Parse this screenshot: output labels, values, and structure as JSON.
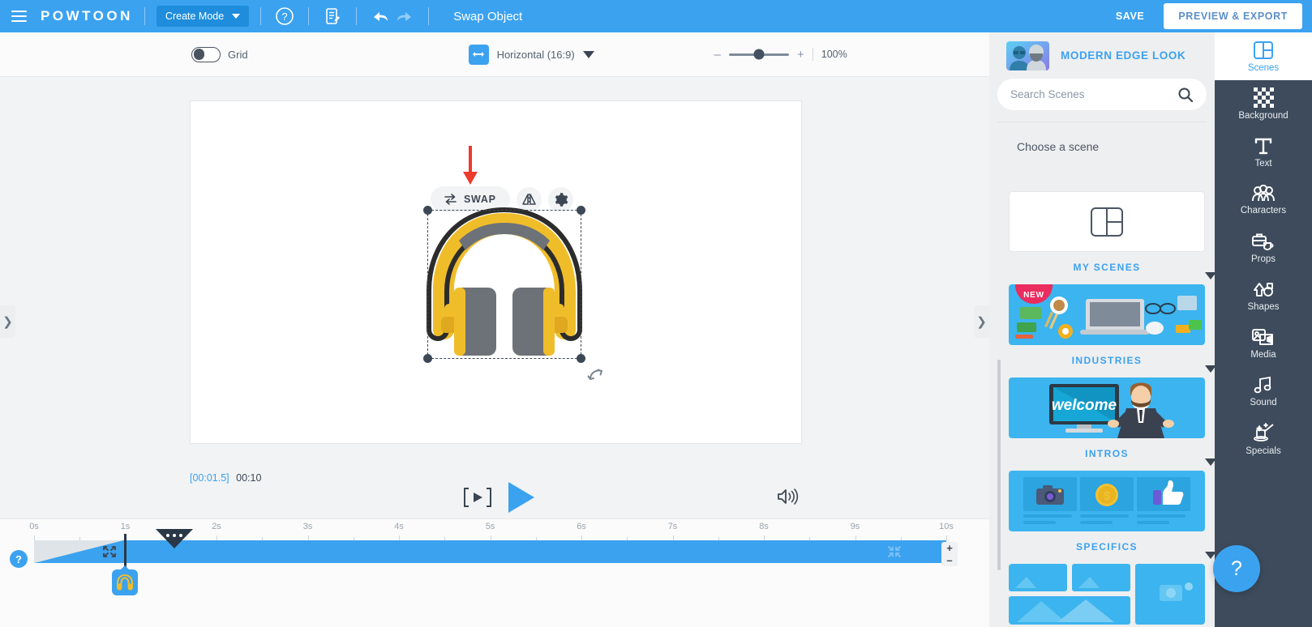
{
  "header": {
    "brand": "POWTOON",
    "menu_icon": "hamburger-icon",
    "create_mode_label": "Create Mode",
    "help_icon": "help-circle-icon",
    "notes_icon": "edit-document-icon",
    "undo_icon": "undo-arrow-icon",
    "redo_icon": "redo-arrow-icon",
    "doc_title": "Swap Object",
    "save_label": "SAVE",
    "preview_export_label": "PREVIEW & EXPORT"
  },
  "toolbar": {
    "grid_label": "Grid",
    "grid_on": false,
    "ratio_label": "Horizontal (16:9)",
    "ratio_icon": "horizontal-resize-icon",
    "zoom_minus": "–",
    "zoom_plus": "+",
    "zoom_value": "100%"
  },
  "object_toolbar": {
    "swap_label": "SWAP",
    "swap_icon": "swap-arrows-icon",
    "flip_icon": "flip-horizontal-icon",
    "settings_icon": "gear-icon",
    "pointer_icon": "red-down-arrow-annotation"
  },
  "canvas": {
    "object_name": "headphones-illustration",
    "left_collapse_icon": "chevron-right-icon",
    "right_collapse_icon": "chevron-right-icon",
    "rotate_icon": "rotate-handle-icon"
  },
  "playback": {
    "current_time": "[00:01.5]",
    "total_time": "00:10",
    "frame_icon": "frame-step-icon",
    "play_icon": "play-triangle-icon",
    "sound_icon": "speaker-on-icon"
  },
  "timeline": {
    "ticks": [
      "0s",
      "1s",
      "2s",
      "3s",
      "4s",
      "5s",
      "6s",
      "7s",
      "8s",
      "9s",
      "10s"
    ],
    "help_label": "?",
    "zoom_in_label": "+",
    "zoom_out_label": "–",
    "expand_icon": "expand-arrows-icon",
    "collapse_icon": "collapse-arrows-icon",
    "scene_menu_icon": "scene-options-dots-icon",
    "object_thumb_icon": "headphones-thumb-icon",
    "playhead_icon": "playhead-marker"
  },
  "right_panel": {
    "look_title": "MODERN EDGE LOOK",
    "look_thumb_icon": "characters-avatar-thumb",
    "look_caret_icon": "chevron-down-icon",
    "search_placeholder": "Search Scenes",
    "search_value": "",
    "search_icon": "search-icon",
    "choose_title": "Choose a scene",
    "scenes": [
      {
        "label": "MY SCENES",
        "thumb": "blank-layout-icon",
        "badge": ""
      },
      {
        "label": "INDUSTRIES",
        "thumb": "desk-workspace-image",
        "badge": "NEW"
      },
      {
        "label": "INTROS",
        "thumb": "welcome-presenter-image",
        "badge": ""
      },
      {
        "label": "SPECIFICS",
        "thumb": "three-card-icons-image",
        "badge": ""
      },
      {
        "label": "",
        "thumb": "photo-grid-image",
        "badge": ""
      }
    ]
  },
  "rail": {
    "items": [
      {
        "label": "Scenes",
        "icon": "layout-panels-icon",
        "active": true
      },
      {
        "label": "Background",
        "icon": "checkerboard-icon",
        "active": false
      },
      {
        "label": "Text",
        "icon": "text-t-icon",
        "active": false
      },
      {
        "label": "Characters",
        "icon": "people-group-icon",
        "active": false
      },
      {
        "label": "Props",
        "icon": "briefcase-cup-icon",
        "active": false
      },
      {
        "label": "Shapes",
        "icon": "shapes-icon",
        "active": false
      },
      {
        "label": "Media",
        "icon": "image-video-icon",
        "active": false
      },
      {
        "label": "Sound",
        "icon": "music-note-icon",
        "active": false
      },
      {
        "label": "Specials",
        "icon": "magic-hat-icon",
        "active": false
      }
    ],
    "help_fab_label": "?",
    "help_fab_icon": "question-mark-icon"
  },
  "colors": {
    "brand_blue": "#3ba2f0",
    "rail_dark": "#3d4b5c",
    "accent_red": "#ea3b2f",
    "badge_pink": "#ea2c5f"
  }
}
